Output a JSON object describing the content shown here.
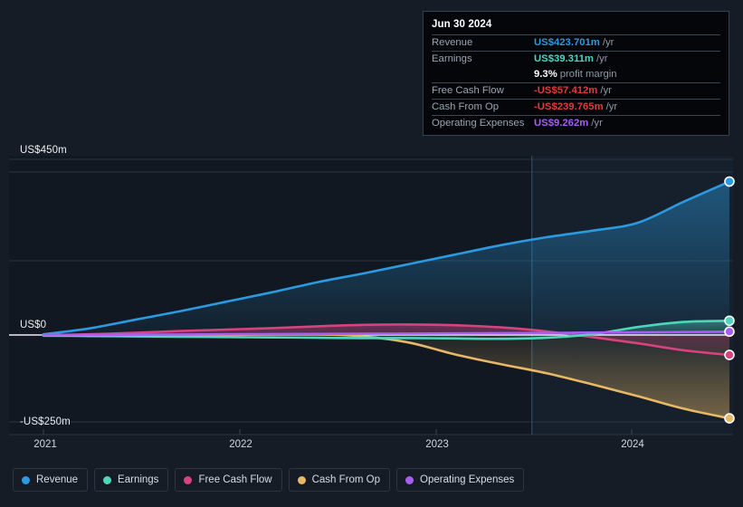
{
  "chart_data": {
    "type": "area",
    "title": "",
    "xlabel": "",
    "ylabel": "",
    "grid": true,
    "legend_position": "bottom",
    "x_ticks": [
      "2021",
      "2022",
      "2023",
      "2024"
    ],
    "y_ticks": [
      "US$450m",
      "US$0",
      "-US$250m"
    ],
    "ylim": [
      -250,
      450
    ],
    "xlim": [
      2020.78,
      2024.6
    ],
    "forecast_divider_x": 2023.5,
    "units": "US$m per year",
    "x": [
      2020.78,
      2021.0,
      2021.25,
      2021.5,
      2021.75,
      2022.0,
      2022.25,
      2022.5,
      2022.75,
      2023.0,
      2023.25,
      2023.5,
      2023.75,
      2024.0,
      2024.25,
      2024.5
    ],
    "series": [
      {
        "name": "Revenue",
        "color": "#2b9ae0",
        "values": [
          2,
          18,
          42,
          66,
          92,
          118,
          146,
          170,
          196,
          222,
          248,
          270,
          288,
          310,
          368,
          423.701
        ]
      },
      {
        "name": "Earnings",
        "color": "#4ed6bd",
        "values": [
          -2,
          -3,
          -4,
          -5,
          -6,
          -7,
          -8,
          -9,
          -9,
          -10,
          -11,
          -8,
          2,
          22,
          36,
          39.311
        ]
      },
      {
        "name": "Free Cash Flow",
        "color": "#d6437e",
        "values": [
          -1,
          2,
          6,
          11,
          15,
          19,
          24,
          28,
          29,
          27,
          21,
          10,
          -6,
          -24,
          -44,
          -57.412
        ]
      },
      {
        "name": "Cash From Op",
        "color": "#e8b866",
        "values": [
          0,
          0,
          0,
          0,
          0,
          2,
          2,
          -4,
          -22,
          -56,
          -84,
          -110,
          -142,
          -176,
          -212,
          -239.765
        ]
      },
      {
        "name": "Operating Expenses",
        "color": "#a85ef0",
        "values": [
          0.2,
          0.6,
          1.0,
          1.5,
          2.0,
          2.5,
          3.0,
          3.5,
          4.0,
          4.6,
          5.2,
          5.9,
          6.6,
          7.4,
          8.3,
          9.262
        ]
      }
    ]
  },
  "tooltip": {
    "date": "Jun 30 2024",
    "rows": [
      {
        "key": "Revenue",
        "value": "US$423.701m",
        "suffix": "/yr",
        "color": "#2b9ae0"
      },
      {
        "key": "Earnings",
        "value": "US$39.311m",
        "suffix": "/yr",
        "color": "#4ed6bd"
      },
      {
        "key": "",
        "value": "9.3%",
        "suffix": "profit margin",
        "color": "#ffffff"
      },
      {
        "key": "Free Cash Flow",
        "value": "-US$57.412m",
        "suffix": "/yr",
        "color": "#e03b3b"
      },
      {
        "key": "Cash From Op",
        "value": "-US$239.765m",
        "suffix": "/yr",
        "color": "#e03b3b"
      },
      {
        "key": "Operating Expenses",
        "value": "US$9.262m",
        "suffix": "/yr",
        "color": "#a85ef0"
      }
    ]
  },
  "legend": {
    "items": [
      {
        "label": "Revenue",
        "color": "#2b9ae0"
      },
      {
        "label": "Earnings",
        "color": "#4ed6bd"
      },
      {
        "label": "Free Cash Flow",
        "color": "#d6437e"
      },
      {
        "label": "Cash From Op",
        "color": "#e8b866"
      },
      {
        "label": "Operating Expenses",
        "color": "#a85ef0"
      }
    ]
  },
  "theme": {
    "background": "#151c26",
    "plot_background": "#111821",
    "forecast_background": "#15202c",
    "grid_color": "#2a3340",
    "zero_line_color": "#e9eef5",
    "axis_text": "#cfd6e0"
  }
}
